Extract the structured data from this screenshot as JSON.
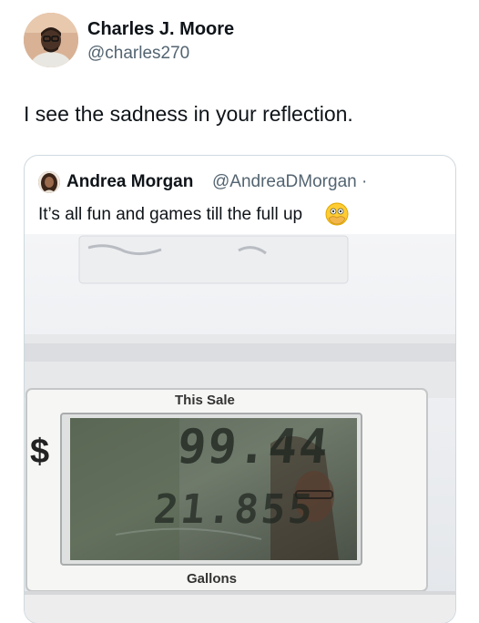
{
  "post": {
    "author_name": "Charles J. Moore",
    "author_handle": "@charles270",
    "text": "I see the sadness in your reflection.",
    "avatar_icon": "person-avatar"
  },
  "quoted": {
    "author_name": "Andrea Morgan",
    "author_handle": "@AndreaDMorgan ·",
    "text": "It’s all fun and games till the full up",
    "emoji_icon": "flushed-face-hands-over-mouth-emoji"
  },
  "pump": {
    "this_sale_label": "This Sale",
    "gallons_label": "Gallons",
    "currency_symbol": "$",
    "sale_display": "99.44",
    "gallons_display": "21.855"
  },
  "colors": {
    "text_primary": "#0f1419",
    "text_secondary": "#536471",
    "border": "#cfd9de"
  }
}
